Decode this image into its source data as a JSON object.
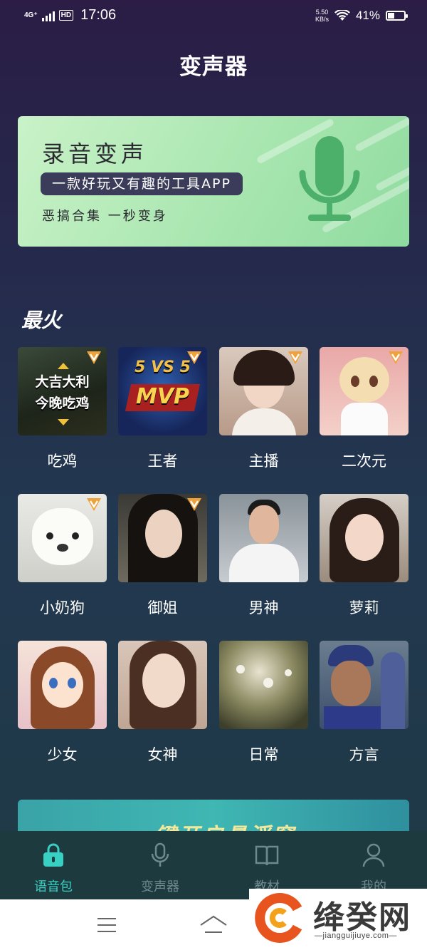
{
  "status_bar": {
    "network": "4G⁺",
    "hd": "HD",
    "time": "17:06",
    "speed_value": "5.50",
    "speed_unit": "KB/s",
    "battery_pct_text": "41%",
    "battery_level": 0.41
  },
  "header": {
    "title": "变声器"
  },
  "banner": {
    "title": "录音变声",
    "tagline": "一款好玩又有趣的工具APP",
    "subtitle": "恶搞合集  一秒变身",
    "icon": "microphone-icon"
  },
  "section": {
    "title": "最火"
  },
  "packs": [
    {
      "label": "吃鸡",
      "vip": true,
      "thumb_line1": "大吉大利",
      "thumb_line2": "今晚吃鸡"
    },
    {
      "label": "王者",
      "vip": true,
      "thumb_line1": "5 VS 5",
      "thumb_line2": "MVP"
    },
    {
      "label": "主播",
      "vip": true
    },
    {
      "label": "二次元",
      "vip": true
    },
    {
      "label": "小奶狗",
      "vip": true
    },
    {
      "label": "御姐",
      "vip": true
    },
    {
      "label": "男神",
      "vip": false
    },
    {
      "label": "萝莉",
      "vip": false
    },
    {
      "label": "少女",
      "vip": false
    },
    {
      "label": "女神",
      "vip": false
    },
    {
      "label": "日常",
      "vip": false
    },
    {
      "label": "方言",
      "vip": false
    }
  ],
  "promo": {
    "text": "一键开启悬浮窗"
  },
  "tabs": [
    {
      "label": "语音包",
      "icon": "lock-bag-icon",
      "active": true
    },
    {
      "label": "变声器",
      "icon": "microphone-icon",
      "active": false
    },
    {
      "label": "教材",
      "icon": "book-icon",
      "active": false
    },
    {
      "label": "我的",
      "icon": "person-icon",
      "active": false
    }
  ],
  "watermark": {
    "name": "绛癸网",
    "url": "—jiangguijiuye.com—"
  },
  "colors": {
    "accent": "#39d0c4",
    "banner": "#a9e6b0",
    "vip": "#f0a23a"
  }
}
